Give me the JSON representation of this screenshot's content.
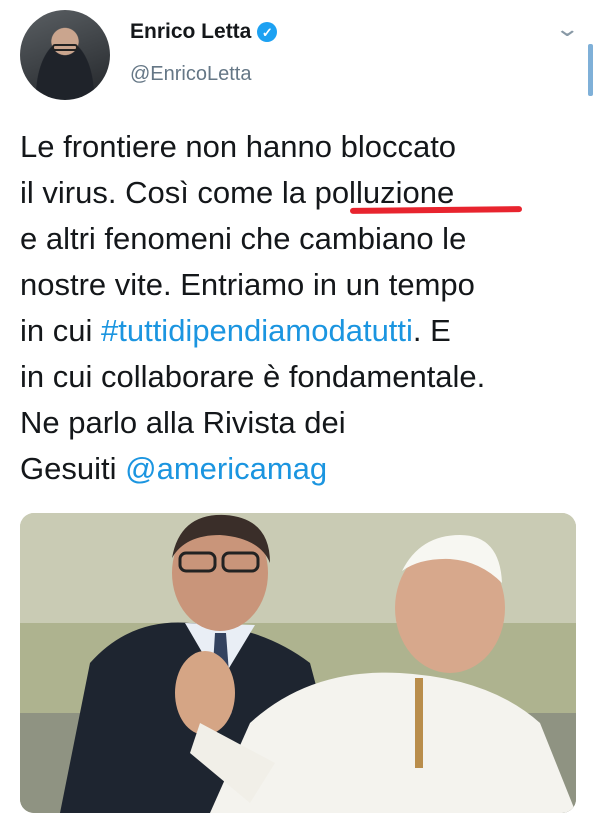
{
  "author": {
    "name": "Enrico Letta",
    "handle": "@EnricoLetta",
    "verified_icon": "verified-checkmark-icon",
    "avatar": "profile-avatar"
  },
  "header": {
    "menu_icon": "chevron-down-icon"
  },
  "tweet": {
    "lines": [
      {
        "parts": [
          {
            "text": "Le frontiere non hanno bloccato"
          }
        ]
      },
      {
        "parts": [
          {
            "text": "il virus. Così come la "
          },
          {
            "text": "polluzione",
            "marked": true
          }
        ]
      },
      {
        "parts": [
          {
            "text": "e altri fenomeni che cambiano le"
          }
        ]
      },
      {
        "parts": [
          {
            "text": "nostre vite. Entriamo in un tempo"
          }
        ]
      },
      {
        "parts": [
          {
            "text": "in cui "
          },
          {
            "text": "#tuttidipendiamodatutti",
            "link": true
          },
          {
            "text": ". E"
          }
        ]
      },
      {
        "parts": [
          {
            "text": "in cui collaborare è fondamentale."
          }
        ]
      },
      {
        "parts": [
          {
            "text": "Ne parlo alla Rivista dei"
          }
        ]
      },
      {
        "parts": [
          {
            "text": "Gesuiti "
          },
          {
            "text": "@americamag",
            "link": true
          }
        ]
      }
    ],
    "link_color": "#1b95e0",
    "annotation_color": "#e8242e"
  },
  "media": {
    "kind": "photo",
    "subject": "two men outdoors"
  }
}
